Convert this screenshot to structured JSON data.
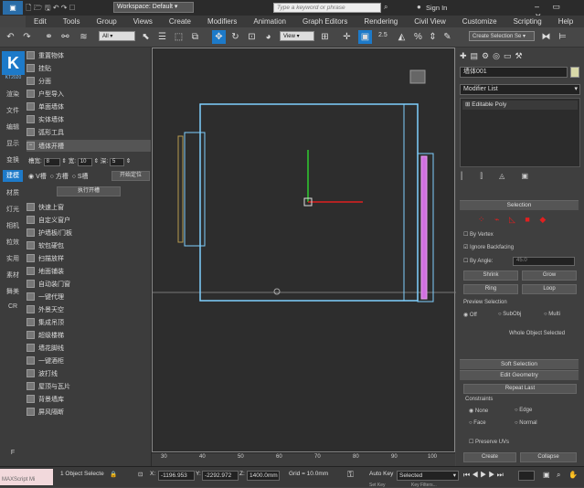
{
  "titlebar": {
    "workspace": "Workspace: Default",
    "search_placeholder": "Type a keyword or phrase",
    "sign_in": "Sign In"
  },
  "menus": [
    "Edit",
    "Tools",
    "Group",
    "Views",
    "Create",
    "Modifiers",
    "Animation",
    "Graph Editors",
    "Rendering",
    "Civil View",
    "Customize",
    "Scripting",
    "Help"
  ],
  "toolbar": {
    "filter_value": "All",
    "refcoord_value": "View",
    "spinner_snap": "2.5",
    "selection_set_placeholder": "Create Selection Se"
  },
  "left_tabs": [
    "渲染",
    "文件",
    "编辑",
    "显示",
    "变换",
    "建模",
    "材质",
    "灯光",
    "相机",
    "粒效",
    "实用",
    "素材",
    "舞美",
    "CR",
    "F"
  ],
  "logo": {
    "letter": "K",
    "version": "KT2020"
  },
  "plugin_items_top": [
    "重置物体",
    "挂贴",
    "分面",
    "户型导入",
    "单面墙体",
    "实体墙体",
    "弧形工具",
    "墙体开槽"
  ],
  "groove": {
    "width_label": "槽宽:",
    "width_value": "8",
    "depth_label": "宽:",
    "depth_value": "10",
    "deep_label": "深:",
    "deep_value": "5",
    "v_label": "V槽",
    "square_label": "方槽",
    "s_label": "S槽",
    "start_pos": "开始定位",
    "exec": "执行开槽"
  },
  "plugin_items_bottom": [
    "快速上窗",
    "自定义窗户",
    "护墙板/门板",
    "软包硬包",
    "扫描放样",
    "地面铺装",
    "自动装门窗",
    "一键代理",
    "外景天空",
    "集成吊顶",
    "超级楼梯",
    "墙花脚线",
    "一键酒柜",
    "波打线",
    "屋顶与瓦片",
    "背景墙库",
    "屏风隔断"
  ],
  "ruler": [
    "30",
    "40",
    "50",
    "60",
    "70",
    "80",
    "90",
    "100"
  ],
  "command_panel": {
    "object_name": "墙体001",
    "modifier_list": "Modifier List",
    "stack_item": "Editable Poly",
    "selection_title": "Selection",
    "by_vertex": "By Vertex",
    "ignore_backfacing": "Ignore Backfacing",
    "by_angle": "By Angle:",
    "angle_value": "45.0",
    "shrink": "Shrink",
    "grow": "Grow",
    "ring": "Ring",
    "loop": "Loop",
    "preview_title": "Preview Selection",
    "off": "Off",
    "subobj": "SubObj",
    "multi": "Multi",
    "whole_object": "Whole Object Selected",
    "soft_selection": "Soft Selection",
    "edit_geometry": "Edit Geometry",
    "repeat_last": "Repeat Last",
    "constraints": "Constraints",
    "none": "None",
    "edge": "Edge",
    "face": "Face",
    "normal": "Normal",
    "preserve_uvs": "Preserve UVs",
    "create": "Create",
    "collapse": "Collapse"
  },
  "status": {
    "maxscript": "MAXScript Mi",
    "selected": "1 Object Selecte",
    "x_label": "X:",
    "x_value": "-1196.953",
    "y_label": "Y:",
    "y_value": "-2292.972",
    "z_label": "Z:",
    "z_value": "1400.0mm",
    "grid": "Grid = 10.0mm",
    "auto_key": "Auto Key",
    "selected_dd": "Selected",
    "set_key": "Set Key",
    "key_filters": "Key Filters..."
  },
  "colors": {
    "accent_blue": "#1d7ac9",
    "selection_cyan": "#7fd0ff",
    "magenta": "#d070e0",
    "axis_green": "#2ecc2e",
    "axis_red": "#e02020"
  }
}
